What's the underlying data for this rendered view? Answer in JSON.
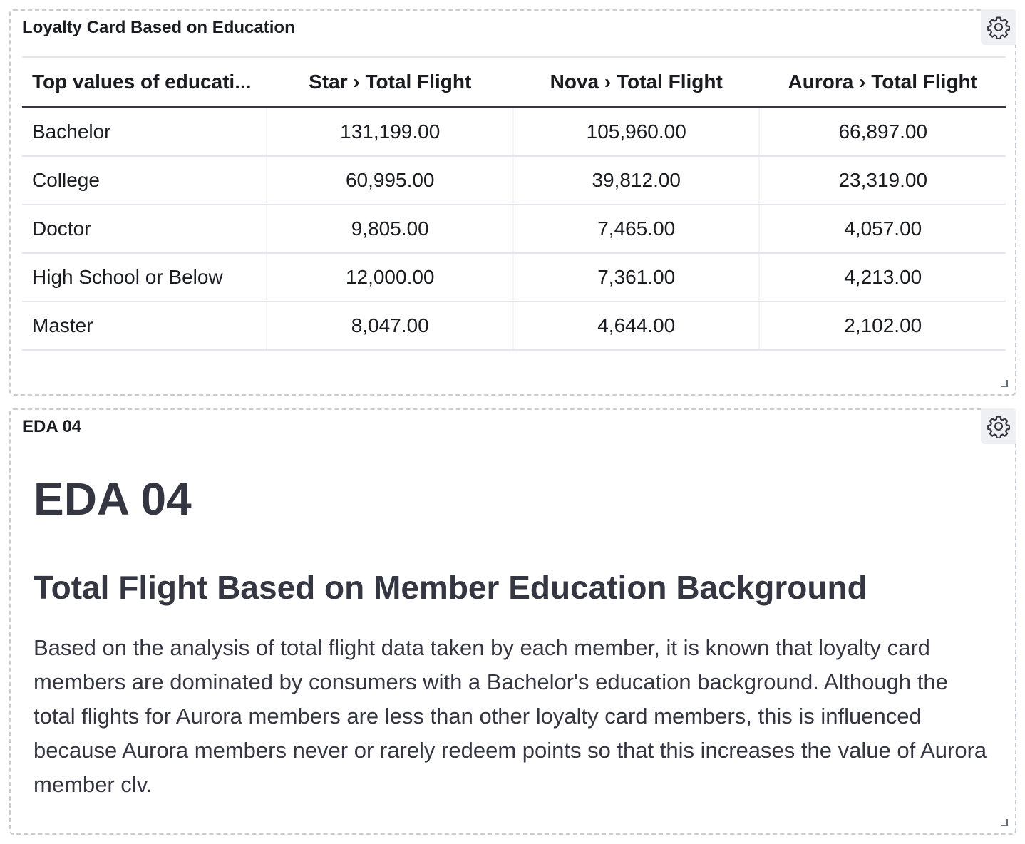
{
  "table_panel": {
    "title": "Loyalty Card Based on Education",
    "columns": [
      "Top values of educati...",
      "Star › Total Flight",
      "Nova › Total Flight",
      "Aurora › Total Flight"
    ],
    "rows": [
      [
        "Bachelor",
        "131,199.00",
        "105,960.00",
        "66,897.00"
      ],
      [
        "College",
        "60,995.00",
        "39,812.00",
        "23,319.00"
      ],
      [
        "Doctor",
        "9,805.00",
        "7,465.00",
        "4,057.00"
      ],
      [
        "High School or Below",
        "12,000.00",
        "7,361.00",
        "4,213.00"
      ],
      [
        "Master",
        "8,047.00",
        "4,644.00",
        "2,102.00"
      ]
    ]
  },
  "markdown_panel": {
    "title": "EDA 04",
    "heading1": "EDA 04",
    "heading2": "Total Flight Based on Member Education Background",
    "paragraph": "Based on the analysis of total flight data taken by each member, it is known that loyalty card members are dominated by consumers with a Bachelor's education background. Although the total flights for Aurora members are less than other loyalty card members, this is influenced because Aurora members never or rarely redeem points so that this increases the value of Aurora member clv."
  },
  "icons": {
    "settings": "gear-icon",
    "resize": "resize-handle-icon"
  }
}
